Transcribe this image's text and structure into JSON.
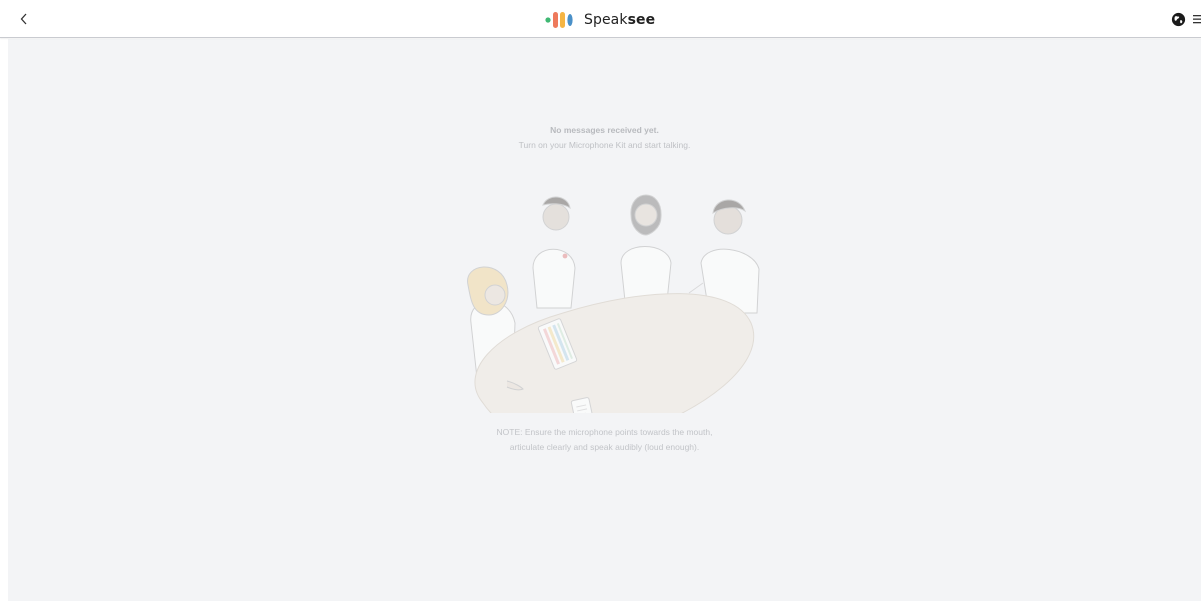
{
  "header": {
    "back_icon": "chevron-left-icon",
    "brand": {
      "name_regular": "Speak",
      "name_bold": "see",
      "logo_colors": [
        "#3fb873",
        "#ee7a5c",
        "#f5b544",
        "#4a90c8"
      ]
    },
    "right_icons": [
      "globe-icon",
      "menu-icon"
    ]
  },
  "empty_state": {
    "title": "No messages received yet.",
    "subtitle": "Turn on your Microphone Kit and start talking.",
    "illustration": "meeting-table-illustration",
    "note_line1": "NOTE: Ensure the microphone points towards the mouth,",
    "note_line2": "articulate clearly and speak audibly (loud enough)."
  },
  "colors": {
    "background": "#f3f4f6",
    "header": "#ffffff",
    "table": "#efe9df"
  }
}
